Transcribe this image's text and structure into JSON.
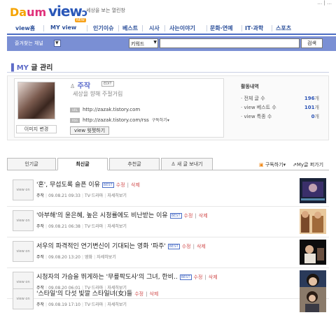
{
  "header": {
    "logo": {
      "d": "D",
      "a": "a",
      "um": "um",
      "view": "view"
    },
    "slogan": "세상을 보는 열린창",
    "top_links": "…  |  …"
  },
  "nav": {
    "new_badge": "NEW",
    "items": [
      {
        "label": "view홈"
      },
      {
        "label": "MY view"
      },
      {
        "label": "인기이슈"
      },
      {
        "label": "베스트"
      },
      {
        "label": "시사"
      },
      {
        "label": "사는이야기"
      },
      {
        "label": "문화·연예"
      },
      {
        "label": "IT·과학"
      },
      {
        "label": "스포츠"
      }
    ]
  },
  "search": {
    "fav_channel": "즐겨찾는 채널",
    "keyword_select": "키워드",
    "input_value": "",
    "button": "검색"
  },
  "section_title": {
    "my": "MY",
    "rest": " 글 관리"
  },
  "profile": {
    "name": "주작",
    "edit": "EDIT",
    "description": "세상을 향해 주절거림",
    "url_label": "URL",
    "url": "http://zazak.tistory.com",
    "rss_label": "RSS",
    "rss": "http://zazak.tistory.com/rss",
    "subscribe_rss": "구독하기▾",
    "image_change": "이미지 변경",
    "widget_button": "view 윗젯하기"
  },
  "stats": {
    "title": "활동내역",
    "rows": [
      {
        "label": "· 전체 글 수",
        "value": "196",
        "unit": "개"
      },
      {
        "label": "· view 베스트 수",
        "value": "101",
        "unit": "개"
      },
      {
        "label": "· view 특종 수",
        "value": "0",
        "unit": "개"
      }
    ]
  },
  "tabs": {
    "items": [
      {
        "label": "인기글"
      },
      {
        "label": "최신글"
      },
      {
        "label": "추천글"
      },
      {
        "label": "새 글 보내기"
      }
    ],
    "subscribe": "구독하기▾",
    "my_page": "My글 퍼가기"
  },
  "posts": [
    {
      "view_label": "view on",
      "title": "'혼', 무섭도록 슬픈 이유",
      "best": "BEST",
      "edit": "수정",
      "delete": "삭제",
      "author": "주작",
      "date": "09.08.21 09:33",
      "category": "TV·드라마",
      "detail": "자세히보기"
    },
    {
      "view_label": "view on",
      "title": "'아부해'의 윤은혜, 높은 시청률에도 비난받는 이유",
      "best": "BEST",
      "edit": "수정",
      "delete": "삭제",
      "author": "주작",
      "date": "09.08.21 06:38",
      "category": "TV·드라마",
      "detail": "자세히보기"
    },
    {
      "view_label": "view on",
      "title": "서우의 파격적인 연기변신이 기대되는 영화 '파주'",
      "best": "BEST",
      "edit": "수정",
      "delete": "삭제",
      "author": "주작",
      "date": "09.08.20 13:20",
      "category": "영화",
      "detail": "자세히보기"
    },
    {
      "view_label": "view on",
      "title": "시청자의 가슴을 뛰게하는 '무릎팍도사'의 그녀, 한비..",
      "best": "BEST",
      "edit": "수정",
      "delete": "삭제",
      "author": "주작",
      "date": "09.08.20 06:01",
      "category": "TV·드라마",
      "detail": "자세히보기"
    },
    {
      "view_label": "view on",
      "title": "'스타일'의 다섯 빛깔 스타일녀(女)들",
      "best": "",
      "edit": "수정",
      "delete": "삭제",
      "author": "주작",
      "date": "09.08.19 17:10",
      "category": "TV·드라마",
      "detail": "자세히보기"
    }
  ]
}
